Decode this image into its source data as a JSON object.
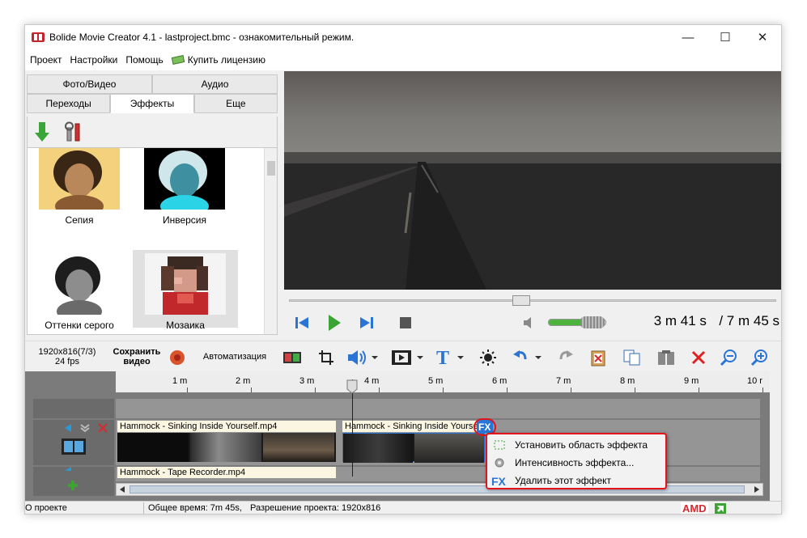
{
  "window": {
    "title": "Bolide Movie Creator 4.1 - lastproject.bmc  - ознакомительный режим.",
    "minimize": "—",
    "maximize": "☐",
    "close": "✕"
  },
  "menu": {
    "project": "Проект",
    "settings": "Настройки",
    "help": "Помощь",
    "buy": "Купить лицензию"
  },
  "tabs": {
    "row1": [
      "Фото/Видео",
      "Аудио"
    ],
    "row2": [
      "Переходы",
      "Эффекты",
      "Еще"
    ],
    "active": "Эффекты"
  },
  "effects": [
    {
      "label": "Сепия"
    },
    {
      "label": "Инверсия"
    },
    {
      "label": "Оттенки серого"
    },
    {
      "label": "Мозаика"
    }
  ],
  "player": {
    "current_time": "3 m 41 s",
    "total_time": "/ 7 m 45 s",
    "seek_progress": 0.475,
    "volume": 0.7
  },
  "toolbar": {
    "resolution": "1920x816(7/3)",
    "fps": "24 fps",
    "save_line1": "Сохранить",
    "save_line2": "видео",
    "automation": "Автоматизация"
  },
  "timeline": {
    "ruler": [
      "1 m",
      "2 m",
      "3 m",
      "4 m",
      "5 m",
      "6 m",
      "7 m",
      "8 m",
      "9 m",
      "10 r"
    ],
    "clips": [
      {
        "label": "Hammock - Sinking Inside Yourself.mp4"
      },
      {
        "label": "Hammock - Sinking Inside Yourself.mp4"
      },
      {
        "label": "Hammock - Tape Recorder.mp4"
      }
    ]
  },
  "context_menu": {
    "items": [
      {
        "label": "Установить область эффекта"
      },
      {
        "label": "Интенсивность эффекта..."
      },
      {
        "label": "Удалить этот эффект"
      }
    ]
  },
  "status": {
    "about": "О проекте",
    "total": "Общее время: 7m 45s,",
    "resolution": "Разрешение проекта:   1920x816",
    "amd": "AMD"
  },
  "colors": {
    "accent": "#e3141b",
    "play_green": "#3ca335",
    "control_blue": "#2a74d6"
  }
}
